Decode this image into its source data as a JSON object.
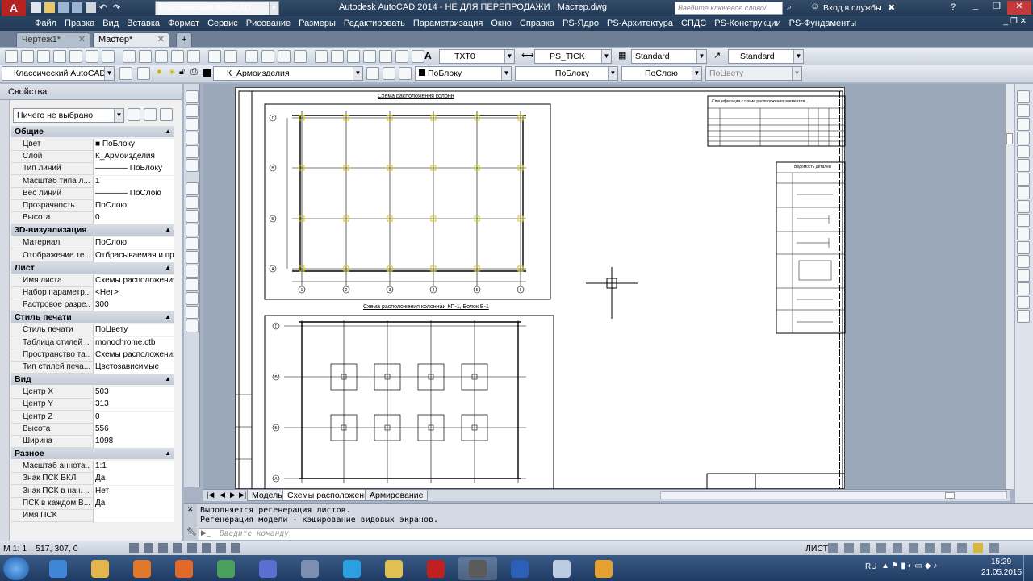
{
  "titlebar": {
    "workspace": "Классический AutoCAD",
    "title": "Autodesk AutoCAD 2014 - НЕ ДЛЯ ПЕРЕПРОДАЖИ   Мастер.dwg",
    "search_placeholder": "Введите ключевое слово/фразу",
    "login": "Вход в службы"
  },
  "menu": [
    "Файл",
    "Правка",
    "Вид",
    "Вставка",
    "Формат",
    "Сервис",
    "Рисование",
    "Размеры",
    "Редактировать",
    "Параметризация",
    "Окно",
    "Справка",
    "PS-Ядро",
    "PS-Архитектура",
    "СПДС",
    "PS-Конструкции",
    "PS-Фундаменты"
  ],
  "doctabs": {
    "tab1": "Чертеж1*",
    "tab2": "Мастер*"
  },
  "toolbar1": {
    "textstyle": "TXT0",
    "dimstyle": "PS_TICK",
    "tablestyle": "Standard",
    "mleaderstyle": "Standard"
  },
  "toolbar2": {
    "workspace": "Классический AutoCAD",
    "layer": "К_Армоизделия",
    "color": "ПоБлоку",
    "linetype": "ПоБлоку",
    "lineweight": "ПоСлою",
    "plotstyle": "ПоЦвету"
  },
  "props": {
    "title": "Свойства",
    "selection": "Ничего не выбрано",
    "sections": {
      "general": "Общие",
      "viz3d": "3D-визуализация",
      "sheet": "Лист",
      "plotstyle": "Стиль печати",
      "view": "Вид",
      "misc": "Разное"
    },
    "rows": {
      "r1": [
        "Цвет",
        "■ ПоБлоку"
      ],
      "r2": [
        "Слой",
        "К_Армоизделия"
      ],
      "r3": [
        "Тип линий",
        "———— ПоБлоку"
      ],
      "r4": [
        "Масштаб типа л...",
        "1"
      ],
      "r5": [
        "Вес линий",
        "———— ПоСлою"
      ],
      "r6": [
        "Прозрачность",
        "ПоСлою"
      ],
      "r7": [
        "Высота",
        "0"
      ],
      "r8": [
        "Материал",
        "ПоСлою"
      ],
      "r9": [
        "Отображение те...",
        "Отбрасываемая и пр..."
      ],
      "r10": [
        "Имя листа",
        "Схемы расположения"
      ],
      "r11": [
        "Набор параметр...",
        "<Нет>"
      ],
      "r12": [
        "Растровое разре...",
        "300"
      ],
      "r13": [
        "Стиль печати",
        "ПоЦвету"
      ],
      "r14": [
        "Таблица стилей ...",
        "monochrome.ctb"
      ],
      "r15": [
        "Пространство та...",
        "Схемы расположения"
      ],
      "r16": [
        "Тип стилей печа...",
        "Цветозависимые"
      ],
      "r17": [
        "Центр X",
        "503"
      ],
      "r18": [
        "Центр Y",
        "313"
      ],
      "r19": [
        "Центр Z",
        "0"
      ],
      "r20": [
        "Высота",
        "556"
      ],
      "r21": [
        "Ширина",
        "1098"
      ],
      "r22": [
        "Масштаб аннота...",
        "1:1"
      ],
      "r23": [
        "Знак ПСК ВКЛ",
        "Да"
      ],
      "r24": [
        "Знак ПСК в нач. ...",
        "Нет"
      ],
      "r25": [
        "ПСК в каждом В...",
        "Да"
      ],
      "r26": [
        "Имя ПСК",
        ""
      ]
    }
  },
  "drawing": {
    "title1": "Схема расположения колонн",
    "title2": "Схема расположения колоннаи КП-1, Болок Б-1",
    "axes_v": [
      "1",
      "2",
      "3",
      "4",
      "5",
      "6"
    ],
    "axes_h": [
      "Г",
      "В",
      "Б",
      "А"
    ],
    "spec_title": "Спецификация к схеме расположения элементов...",
    "bom_title": "Ведомость деталей"
  },
  "layouttabs": {
    "model": "Модель",
    "layout1": "Схемы расположения",
    "layout2": "Армирование"
  },
  "cmd": {
    "line1": "Выполняется регенерация листов.",
    "line2": "Регенерация модели - кэширование видовых экранов.",
    "prompt": "Введите команду"
  },
  "status": {
    "scale": "М 1:  1",
    "coords": "517, 307, 0",
    "space": "ЛИСТ"
  },
  "taskbar": {
    "lang": "RU",
    "time": "15:29",
    "date": "21.05.2015"
  }
}
